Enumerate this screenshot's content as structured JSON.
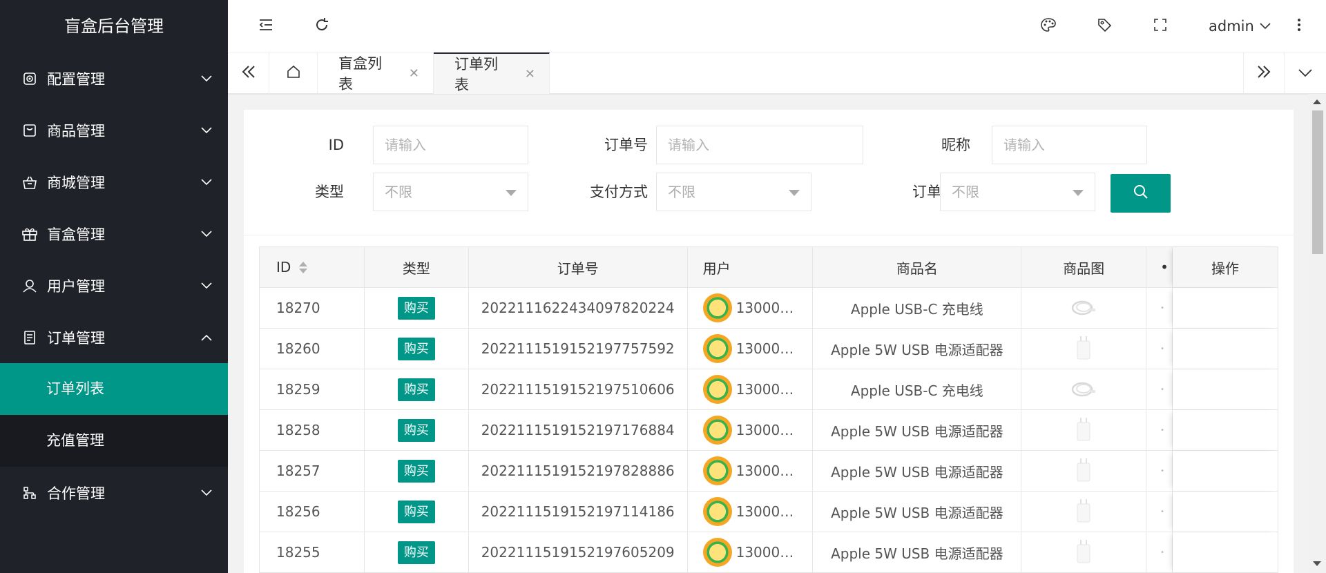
{
  "app": {
    "title": "盲盒后台管理"
  },
  "sidebar": {
    "items": [
      {
        "label": "配置管理",
        "icon": "settings-icon",
        "expanded": false
      },
      {
        "label": "商品管理",
        "icon": "box-icon",
        "expanded": false
      },
      {
        "label": "商城管理",
        "icon": "basket-icon",
        "expanded": false
      },
      {
        "label": "盲盒管理",
        "icon": "gift-icon",
        "expanded": false
      },
      {
        "label": "用户管理",
        "icon": "user-icon",
        "expanded": false
      },
      {
        "label": "订单管理",
        "icon": "document-icon",
        "expanded": true
      },
      {
        "label": "合作管理",
        "icon": "cooperation-icon",
        "expanded": false
      }
    ],
    "order_submenu": [
      {
        "label": "订单列表",
        "active": true
      },
      {
        "label": "充值管理",
        "active": false
      }
    ],
    "active_color": "#009688"
  },
  "header": {
    "user": "admin",
    "icons": [
      "menu-fold-icon",
      "refresh-icon",
      "palette-icon",
      "tag-icon",
      "fullscreen-icon",
      "more-icon"
    ]
  },
  "tabs": [
    {
      "label": "盲盒列表",
      "active": false
    },
    {
      "label": "订单列表",
      "active": true
    }
  ],
  "filters": {
    "id_label": "ID",
    "id_placeholder": "请输入",
    "order_no_label": "订单号",
    "order_no_placeholder": "请输入",
    "nickname_label": "昵称",
    "nickname_placeholder": "请输入",
    "type_label": "类型",
    "type_value": "不限",
    "pay_label": "支付方式",
    "pay_value": "不限",
    "status_label": "订单状态",
    "status_value": "不限"
  },
  "table": {
    "headers": {
      "id": "ID",
      "type": "类型",
      "order_no": "订单号",
      "user": "用户",
      "goods": "商品名",
      "image": "商品图",
      "op": "操作"
    },
    "rows": [
      {
        "id": "18270",
        "type": "购买",
        "order_no": "20221116224340978 20224",
        "user": "13000…",
        "goods": "Apple USB-C 充电线",
        "thumb": "cable"
      },
      {
        "id": "18260",
        "type": "购买",
        "order_no": "2022111519152197757592",
        "user": "13000…",
        "goods": "Apple 5W USB 电源适配器",
        "thumb": "adapter"
      },
      {
        "id": "18259",
        "type": "购买",
        "order_no": "2022111519152197510606",
        "user": "13000…",
        "goods": "Apple USB-C 充电线",
        "thumb": "cable"
      },
      {
        "id": "18258",
        "type": "购买",
        "order_no": "2022111519152197176884",
        "user": "13000…",
        "goods": "Apple 5W USB 电源适配器",
        "thumb": "adapter"
      },
      {
        "id": "18257",
        "type": "购买",
        "order_no": "2022111519152197828886",
        "user": "13000…",
        "goods": "Apple 5W USB 电源适配器",
        "thumb": "adapter"
      },
      {
        "id": "18256",
        "type": "购买",
        "order_no": "2022111519152197114186",
        "user": "13000…",
        "goods": "Apple 5W USB 电源适配器",
        "thumb": "adapter"
      },
      {
        "id": "18255",
        "type": "购买",
        "order_no": "2022111519152197605209",
        "user": "13000…",
        "goods": "Apple 5W USB 电源适配器",
        "thumb": "adapter"
      }
    ]
  }
}
